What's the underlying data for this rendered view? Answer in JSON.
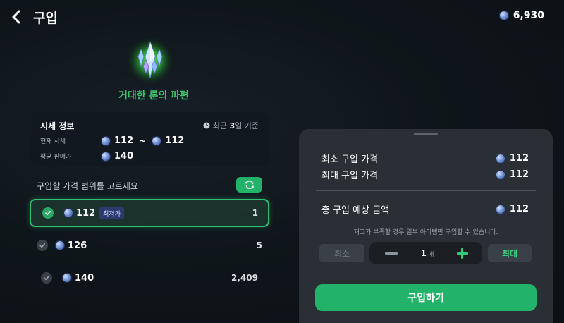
{
  "header": {
    "title": "구입",
    "balance": "6,930"
  },
  "item": {
    "name": "거대한 룬의 파편",
    "icon": "rune-shard-icon"
  },
  "market": {
    "title": "시세 정보",
    "basis_prefix": "최근 ",
    "basis_days": "3",
    "basis_suffix": "일 기준",
    "current_label": "현재 시세",
    "current_min": "112",
    "tilde": "~",
    "current_max": "112",
    "avg_label": "평균 판매가",
    "avg_value": "140"
  },
  "range": {
    "label": "구입할 가격 범위를 고르세요",
    "options": [
      {
        "price": "112",
        "tag": "최저가",
        "qty": "1",
        "selected": true
      },
      {
        "price": "126",
        "qty": "5",
        "selected": false
      },
      {
        "price": "140",
        "qty": "2,409",
        "selected": false
      }
    ]
  },
  "panel": {
    "min_price_label": "최소 구입 가격",
    "min_price": "112",
    "max_price_label": "최대 구입 가격",
    "max_price": "112",
    "total_label": "총 구입 예상 금액",
    "total": "112",
    "notice": "재고가 부족할 경우 일부 아이템만 구입할 수 있습니다.",
    "min_button": "최소",
    "quantity": "1",
    "quantity_unit": "개",
    "max_button": "최대",
    "buy_button": "구입하기"
  },
  "colors": {
    "accent": "#23b26a",
    "item_name": "#3ec46d",
    "panel_bg": "#2a2f35"
  }
}
